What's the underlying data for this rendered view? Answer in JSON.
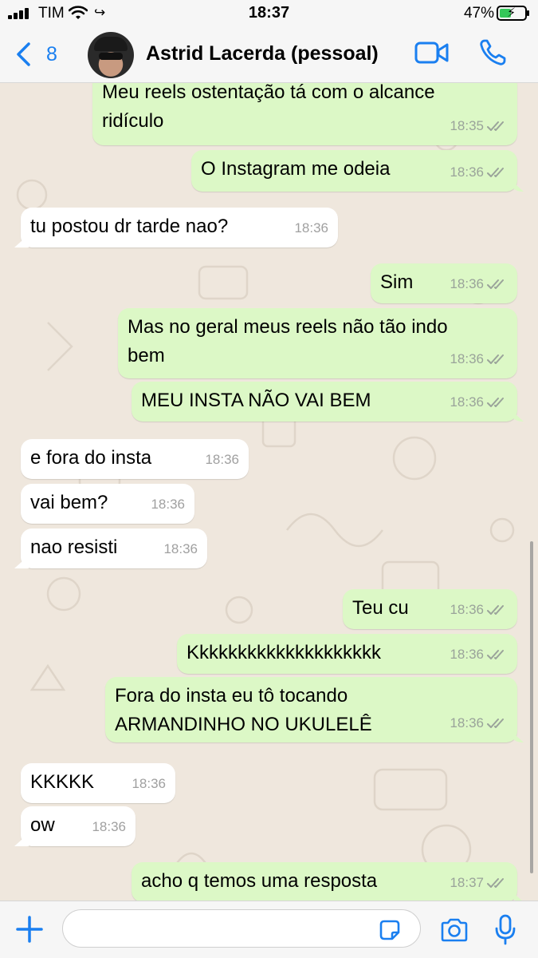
{
  "status_bar": {
    "carrier": "TIM",
    "time": "18:37",
    "battery": "47%",
    "battery_level": 0.47
  },
  "header": {
    "back_count": "8",
    "contact_name": "Astrid Lacerda (pessoal)",
    "icons": [
      "chevron-left-icon",
      "video-call-icon",
      "phone-call-icon"
    ]
  },
  "messages": [
    {
      "dir": "out",
      "text": "Meu reels ostentação tá com o alcance\nridículo",
      "time": "18:35"
    },
    {
      "dir": "out",
      "text": "O Instagram me odeia",
      "time": "18:36"
    },
    {
      "dir": "in",
      "text": "tu postou dr tarde nao?",
      "time": "18:36"
    },
    {
      "dir": "out",
      "text": "Sim",
      "time": "18:36"
    },
    {
      "dir": "out",
      "text": "Mas no geral meus reels não tão indo\nbem",
      "time": "18:36"
    },
    {
      "dir": "out",
      "text": "MEU INSTA NÃO VAI BEM",
      "time": "18:36"
    },
    {
      "dir": "in",
      "text": "e fora do insta",
      "time": "18:36"
    },
    {
      "dir": "in",
      "text": "vai bem?",
      "time": "18:36"
    },
    {
      "dir": "in",
      "text": "nao resisti",
      "time": "18:36"
    },
    {
      "dir": "out",
      "text": "Teu cu",
      "time": "18:36"
    },
    {
      "dir": "out",
      "text": "Kkkkkkkkkkkkkkkkkkkk",
      "time": "18:36"
    },
    {
      "dir": "out",
      "text": "Fora do insta eu tô tocando\nARMANDINHO NO UKULELÊ",
      "time": "18:36"
    },
    {
      "dir": "in",
      "text": "KKKKK",
      "time": "18:36"
    },
    {
      "dir": "in",
      "text": "ow",
      "time": "18:36"
    },
    {
      "dir": "out",
      "text": "acho q temos uma resposta",
      "time": "18:37"
    }
  ],
  "input": {
    "placeholder": "",
    "icons": [
      "plus-icon",
      "sticker-icon",
      "camera-icon",
      "microphone-icon"
    ]
  },
  "colors": {
    "outgoing_bubble": "#dcf8c6",
    "incoming_bubble": "#ffffff",
    "wallpaper": "#efe7dd",
    "accent": "#1a7ff0"
  }
}
